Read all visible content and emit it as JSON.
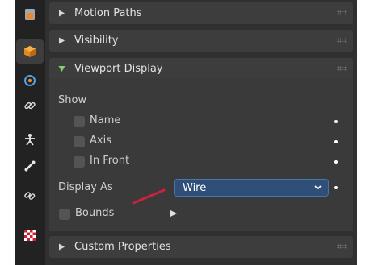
{
  "sidebar": {
    "tabs": [
      {
        "icon": "tool-settings-icon",
        "active": false
      },
      {
        "icon": "object-properties-icon",
        "active": true
      },
      {
        "icon": "physics-icon",
        "active": false
      },
      {
        "icon": "constraints-icon",
        "active": false
      },
      {
        "icon": "object-data-armature-icon",
        "active": false
      },
      {
        "icon": "bone-icon",
        "active": false
      },
      {
        "icon": "bone-constraints-icon",
        "active": false
      },
      {
        "icon": "texture-icon",
        "active": false
      }
    ]
  },
  "panels": {
    "motion_paths": {
      "label": "Motion Paths",
      "expanded": false
    },
    "visibility": {
      "label": "Visibility",
      "expanded": false
    },
    "viewport_display": {
      "label": "Viewport Display",
      "expanded": true
    },
    "custom_properties": {
      "label": "Custom Properties",
      "expanded": false
    }
  },
  "viewport_display": {
    "show_label": "Show",
    "name_label": "Name",
    "axis_label": "Axis",
    "in_front_label": "In Front",
    "display_as_label": "Display As",
    "display_as_value": "Wire",
    "bounds_label": "Bounds"
  },
  "colors": {
    "accent_blue": "#2f4e78",
    "expand_green": "#7fd36b",
    "annotation_red": "#d0213a"
  }
}
